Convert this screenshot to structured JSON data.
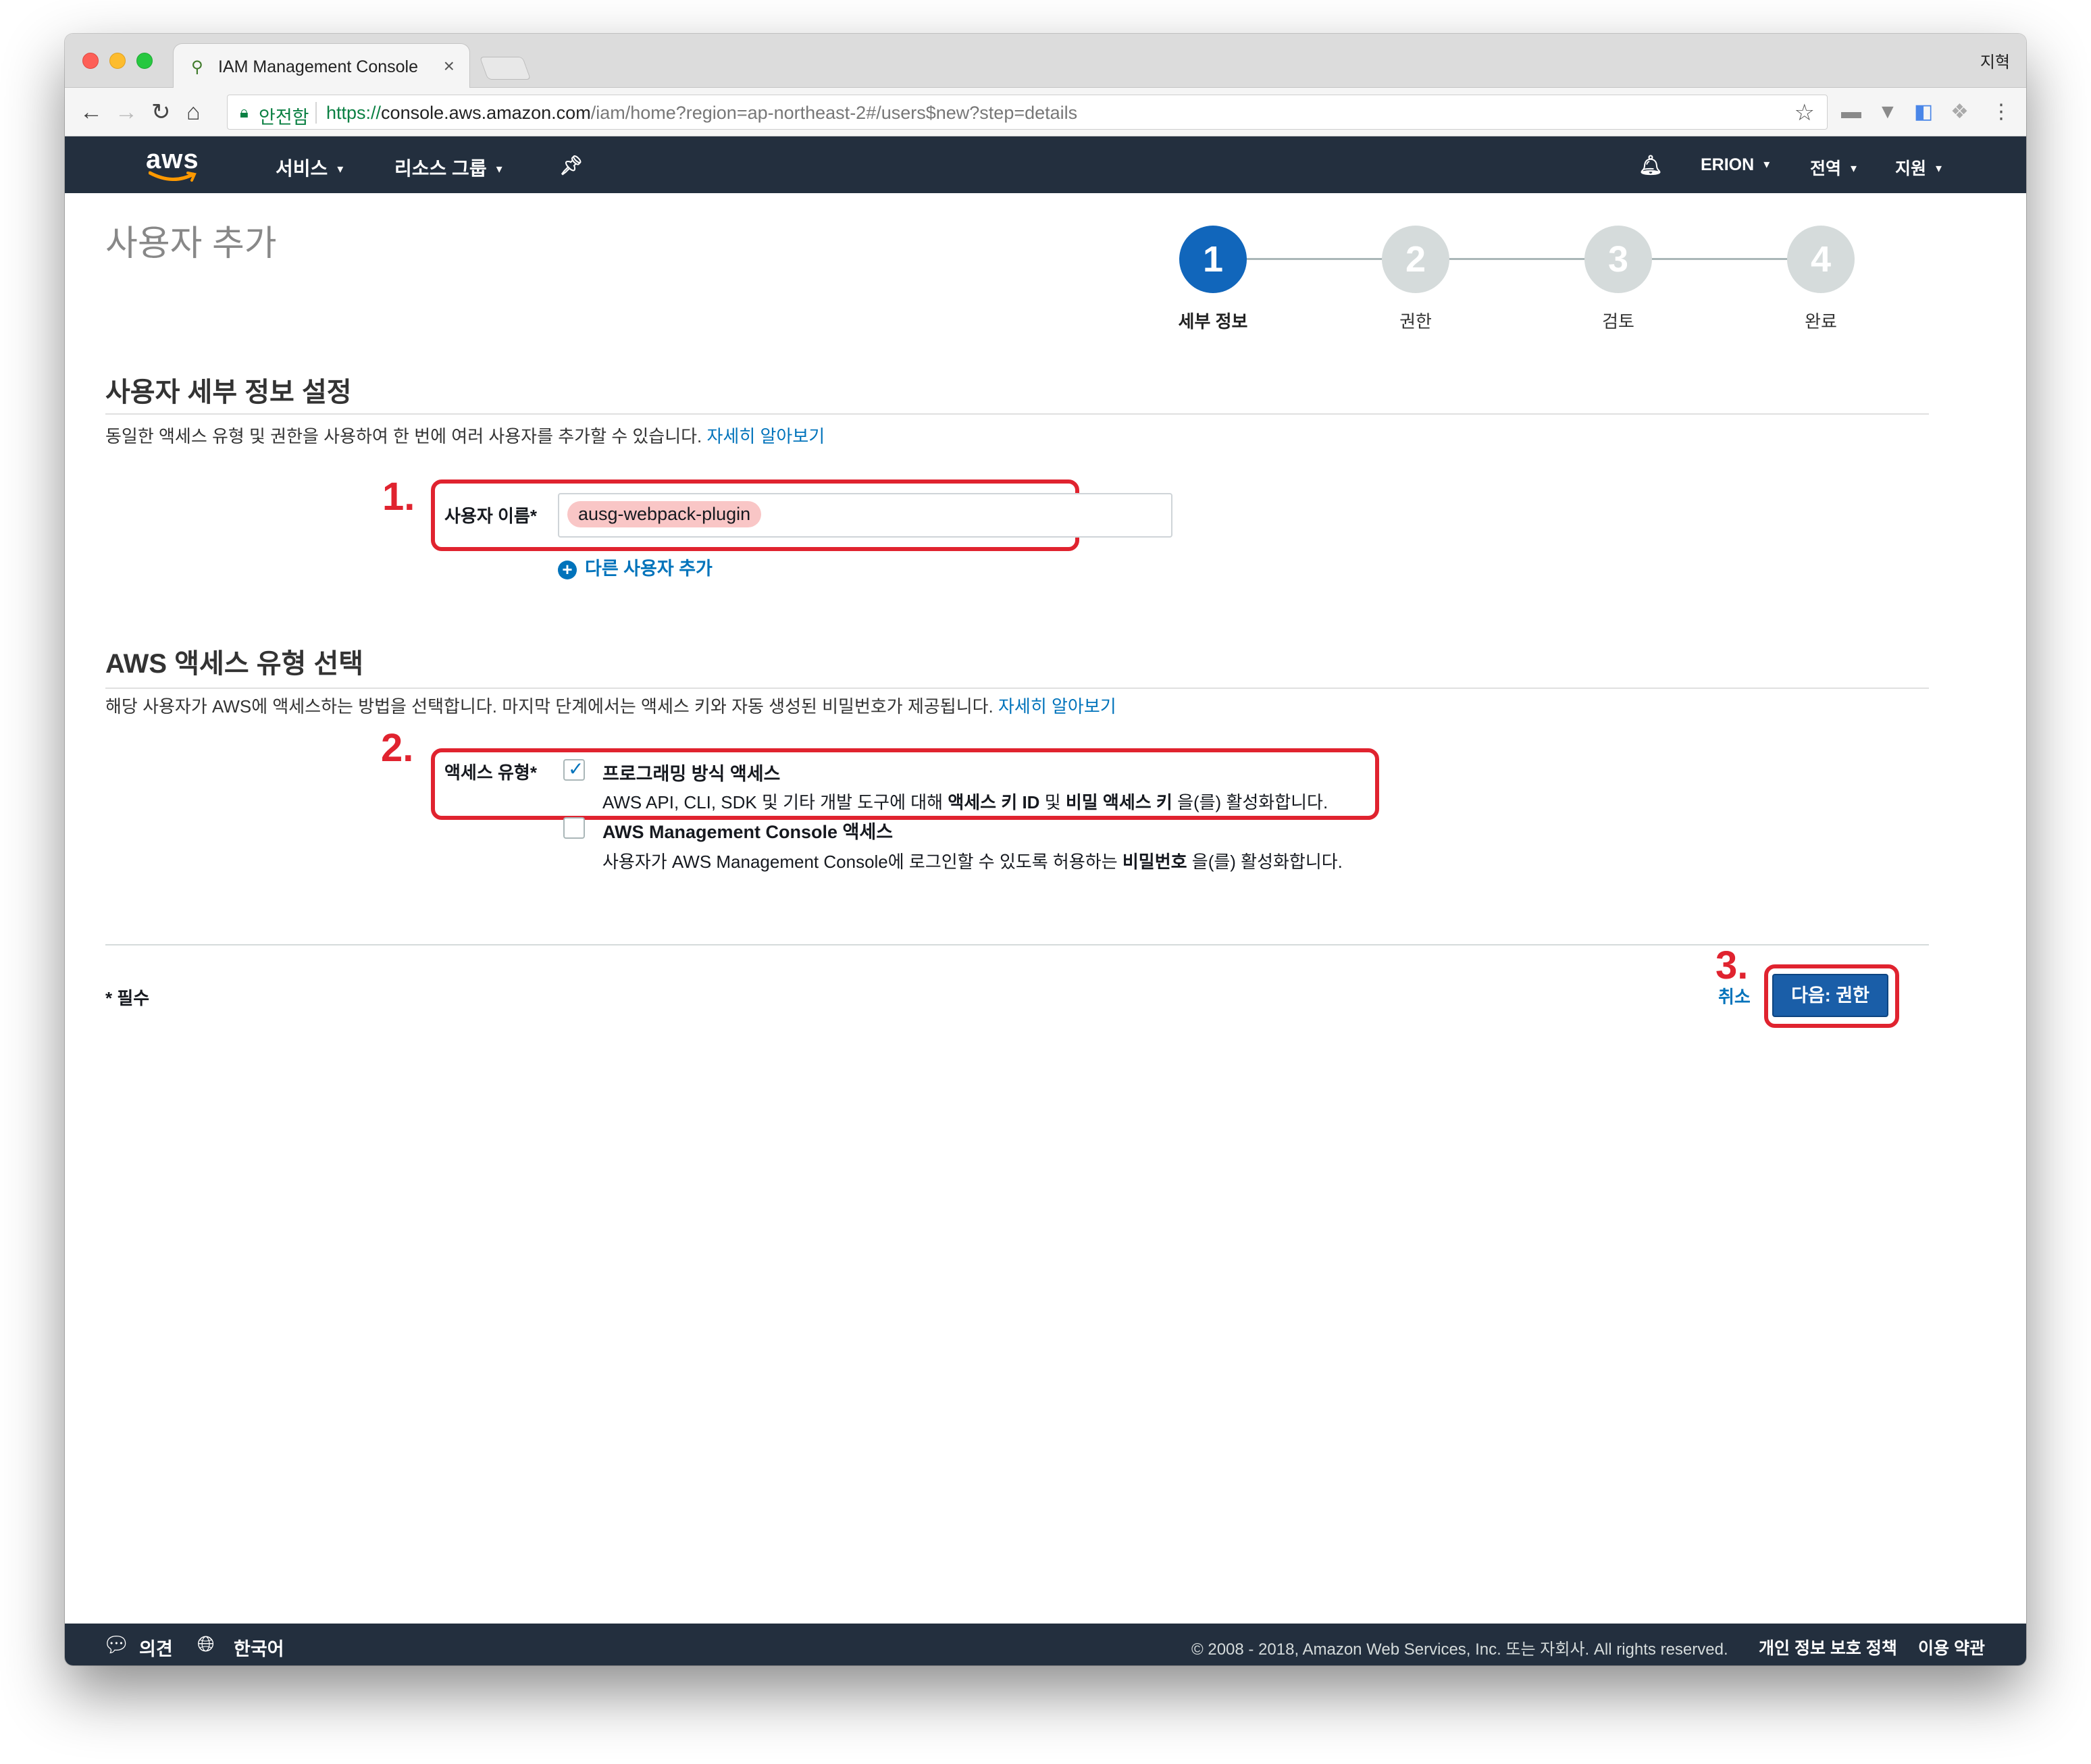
{
  "browser": {
    "tab_title": "IAM Management Console",
    "tab_close": "×",
    "profile_name": "지혁",
    "secure_label": "안전함",
    "url_scheme": "https://",
    "url_host": "console.aws.amazon.com",
    "url_path": "/iam/home?region=ap-northeast-2#/users$new?step=details"
  },
  "aws_header": {
    "logo": "aws",
    "services": "서비스",
    "resource_groups": "리소스 그룹",
    "account": "ERION",
    "region": "전역",
    "support": "지원"
  },
  "page": {
    "title": "사용자 추가"
  },
  "steps": [
    {
      "number": "1",
      "label": "세부 정보",
      "active": true
    },
    {
      "number": "2",
      "label": "권한",
      "active": false
    },
    {
      "number": "3",
      "label": "검토",
      "active": false
    },
    {
      "number": "4",
      "label": "완료",
      "active": false
    }
  ],
  "user_details": {
    "title": "사용자 세부 정보 설정",
    "description": "동일한 액세스 유형 및 권한을 사용하여 한 번에 여러 사용자를 추가할 수 있습니다.",
    "learn_more": "자세히 알아보기",
    "username_label": "사용자 이름*",
    "username_value": "ausg-webpack-plugin",
    "add_another_user": "다른 사용자 추가"
  },
  "access_type": {
    "title": "AWS 액세스 유형 선택",
    "description": "해당 사용자가 AWS에 액세스하는 방법을 선택합니다. 마지막 단계에서는 액세스 키와 자동 생성된 비밀번호가 제공됩니다.",
    "learn_more": "자세히 알아보기",
    "label": "액세스 유형*",
    "programmatic": {
      "title": "프로그래밍 방식 액세스",
      "desc_pre": "AWS API, CLI, SDK 및 기타 개발 도구에 대해",
      "desc_bold1": "액세스 키 ID",
      "desc_mid": "및",
      "desc_bold2": "비밀 액세스 키",
      "desc_post": "을(를) 활성화합니다.",
      "checked": true
    },
    "console": {
      "title": "AWS Management Console 액세스",
      "desc_pre": "사용자가 AWS Management Console에 로그인할 수 있도록 허용하는",
      "desc_bold": "비밀번호",
      "desc_post": "을(를) 활성화합니다.",
      "checked": false
    }
  },
  "footer_actions": {
    "required_note": "* 필수",
    "cancel": "취소",
    "next": "다음: 권한"
  },
  "annotations": {
    "one": "1.",
    "two": "2.",
    "three": "3.",
    "color": "#e0232f"
  },
  "console_footer": {
    "feedback": "의견",
    "language": "한국어",
    "copyright": "© 2008 - 2018, Amazon Web Services, Inc. 또는 자회사. All rights reserved.",
    "privacy": "개인 정보 보호 정책",
    "terms": "이용 약관"
  },
  "colors": {
    "aws_navy": "#232f3e",
    "link_blue": "#0073bb",
    "step_active": "#1166bb",
    "step_inactive": "#d5dbdb",
    "primary_button": "#1a5ea8"
  }
}
